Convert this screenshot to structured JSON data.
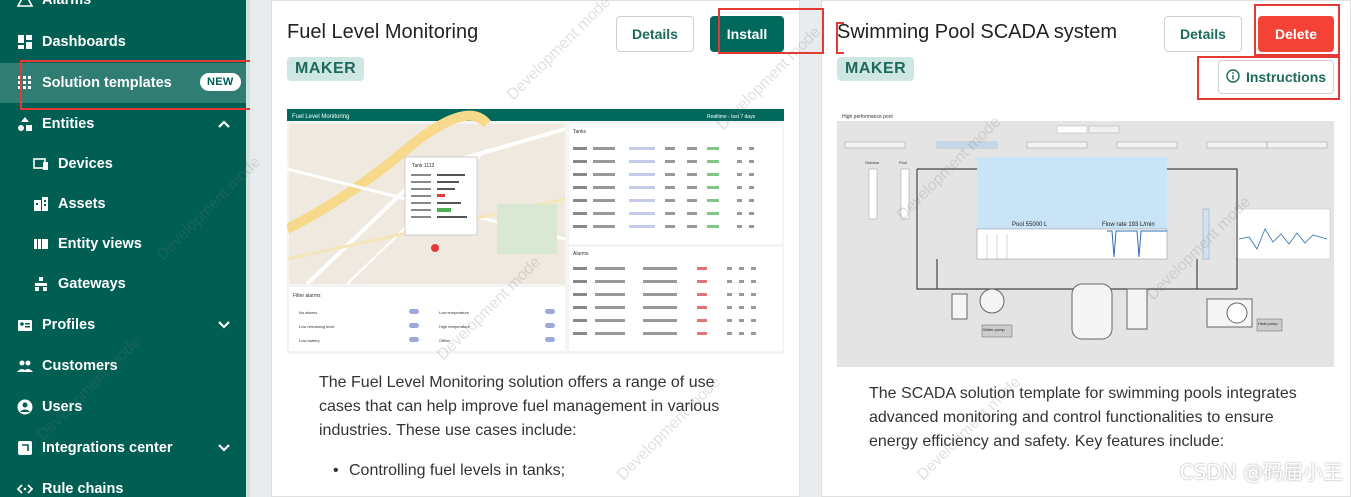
{
  "sidebar": {
    "items": [
      {
        "label": "Alarms"
      },
      {
        "label": "Dashboards"
      },
      {
        "label": "Solution templates",
        "badge": "NEW"
      },
      {
        "label": "Entities"
      },
      {
        "label": "Devices"
      },
      {
        "label": "Assets"
      },
      {
        "label": "Entity views"
      },
      {
        "label": "Gateways"
      },
      {
        "label": "Profiles"
      },
      {
        "label": "Customers"
      },
      {
        "label": "Users"
      },
      {
        "label": "Integrations center"
      },
      {
        "label": "Rule chains"
      }
    ]
  },
  "cards": [
    {
      "title": "Fuel Level Monitoring",
      "tag": "MAKER",
      "details_label": "Details",
      "action_label": "Install",
      "description": "The Fuel Level Monitoring solution offers a range of use cases that can help improve fuel management in various industries. These use cases include:",
      "bullet": "Controlling fuel levels in tanks;"
    },
    {
      "title": "Swimming Pool SCADA system",
      "tag": "MAKER",
      "details_label": "Details",
      "action_label": "Delete",
      "instructions_label": "Instructions",
      "description": "The SCADA solution template for swimming pools integrates advanced monitoring and control functionalities to ensure energy efficiency and safety. Key features include:"
    }
  ],
  "fuel_preview": {
    "header": "Fuel Level Monitoring",
    "realtime": "Realtime - last 7 days",
    "tanks_title": "Tanks",
    "alarms_title": "Alarms",
    "filter_title": "Filter alarms",
    "popup_title": "Tank 1113",
    "filters": [
      "No alarms",
      "Low temperature",
      "Low remaining level",
      "High temperature",
      "Low battery",
      "Offline"
    ]
  },
  "pool_preview": {
    "header": "High performance pool",
    "pool_label": "Pool  55000 L",
    "flow_label": "Flow rate  193 L/min",
    "pump1": "Water pump",
    "pump2": "Heat pump",
    "outdoor": "Outdoor",
    "pool": "Pool"
  },
  "watermark": "CSDN @码届小王",
  "dev_watermark": "Development mode",
  "colors": {
    "sidebar": "#005e53",
    "accent": "#00695c",
    "danger": "#f44336",
    "highlight": "#e53935"
  }
}
